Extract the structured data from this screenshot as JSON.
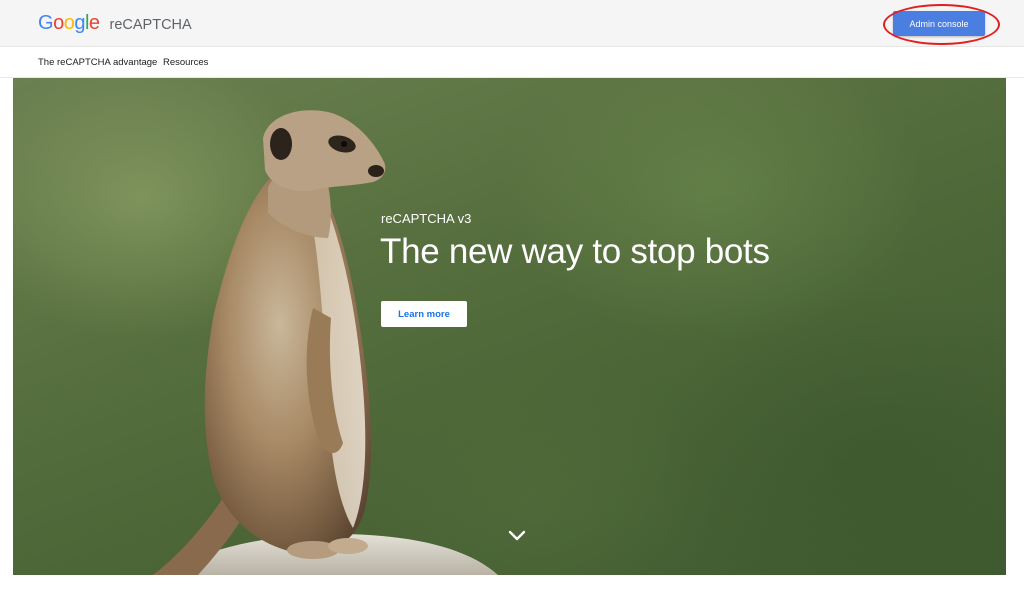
{
  "header": {
    "logo_letters": [
      "G",
      "o",
      "o",
      "g",
      "l",
      "e"
    ],
    "product_name": "reCAPTCHA",
    "admin_button_label": "Admin console"
  },
  "nav": {
    "items": [
      {
        "label": "The reCAPTCHA advantage"
      },
      {
        "label": "Resources"
      }
    ]
  },
  "hero": {
    "eyebrow": "reCAPTCHA v3",
    "title": "The new way to stop bots",
    "cta_label": "Learn more",
    "scroll_icon": "chevron-down-icon"
  },
  "colors": {
    "google_blue": "#4285f4",
    "google_red": "#ea4335",
    "google_yellow": "#fbbc05",
    "google_green": "#34a853",
    "admin_button_bg": "#4a7ee0",
    "highlight_ring": "#e02020",
    "cta_text": "#1a73e8"
  }
}
